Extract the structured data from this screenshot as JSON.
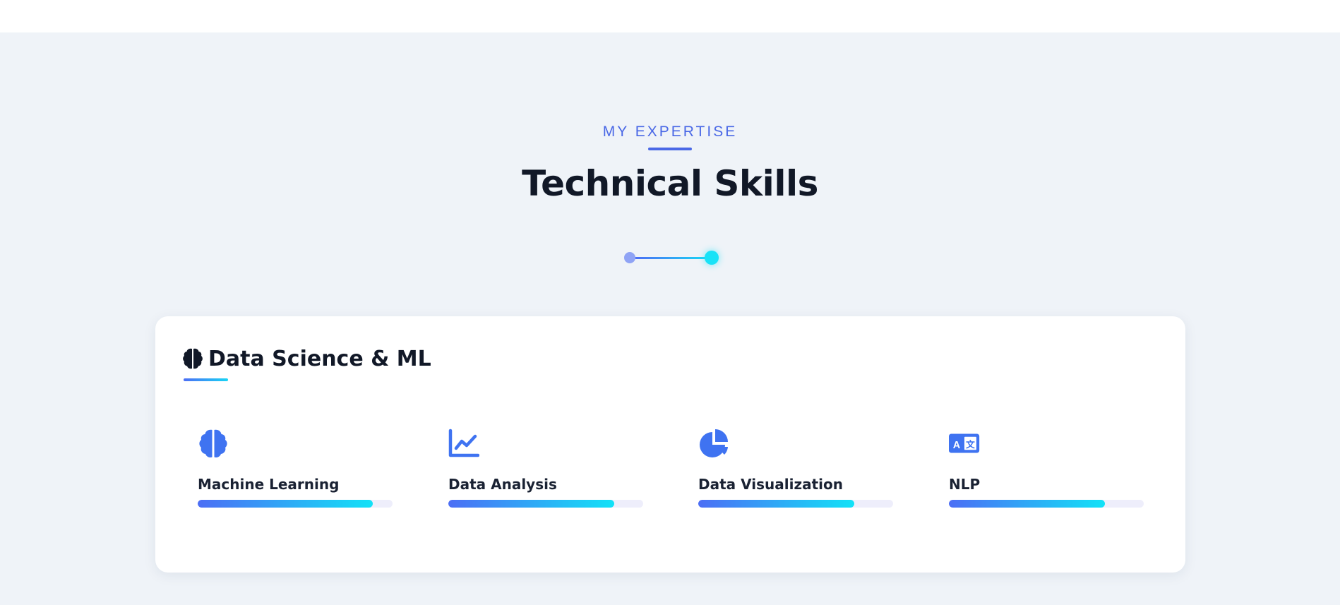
{
  "header": {
    "eyebrow": "MY EXPERTISE",
    "title": "Technical Skills"
  },
  "colors": {
    "accent": "#4a68e6",
    "gradient_start": "#4c6ef5",
    "gradient_end": "#12e2f7",
    "page_bg": "#eff3f8"
  },
  "card": {
    "icon": "brain-icon",
    "title": "Data Science & ML",
    "skills": [
      {
        "label": "Machine Learning",
        "icon": "brain-icon",
        "level": 0.9
      },
      {
        "label": "Data Analysis",
        "icon": "chart-line-icon",
        "level": 0.85
      },
      {
        "label": "Data Visualization",
        "icon": "chart-pie-icon",
        "level": 0.8
      },
      {
        "label": "NLP",
        "icon": "language-icon",
        "level": 0.8
      }
    ]
  }
}
